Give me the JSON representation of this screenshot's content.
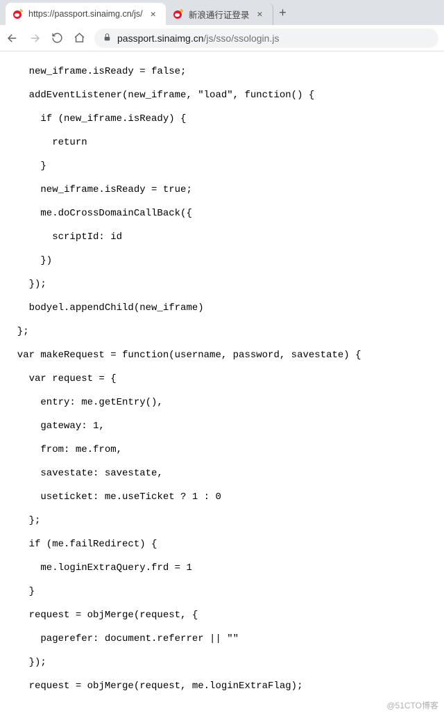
{
  "tabs": {
    "active": {
      "title": "https://passport.sinaimg.cn/js/"
    },
    "inactive": {
      "title": "新浪通行证登录"
    }
  },
  "omnibox": {
    "host": "passport.sinaimg.cn",
    "path": "/js/sso/ssologin.js"
  },
  "watermark": "@51CTO博客",
  "code": {
    "l01": "    new_iframe.isReady = false;",
    "l02": "    addEventListener(new_iframe, \"load\", function() {",
    "l03": "      if (new_iframe.isReady) {",
    "l04": "        return",
    "l05": "      }",
    "l06": "      new_iframe.isReady = true;",
    "l07": "      me.doCrossDomainCallBack({",
    "l08": "        scriptId: id",
    "l09": "      })",
    "l10": "    });",
    "l11": "    bodyel.appendChild(new_iframe)",
    "l12": "  };",
    "l13": "  var makeRequest = function(username, password, savestate) {",
    "l14": "    var request = {",
    "l15": "      entry: me.getEntry(),",
    "l16": "      gateway: 1,",
    "l17": "      from: me.from,",
    "l18": "      savestate: savestate,",
    "l19": "      useticket: me.useTicket ? 1 : 0",
    "l20": "    };",
    "l21": "    if (me.failRedirect) {",
    "l22": "      me.loginExtraQuery.frd = 1",
    "l23": "    }",
    "l24": "    request = objMerge(request, {",
    "l25": "      pagerefer: document.referrer || \"\"",
    "l26": "    });",
    "l27": "    request = objMerge(request, me.loginExtraFlag);"
  }
}
